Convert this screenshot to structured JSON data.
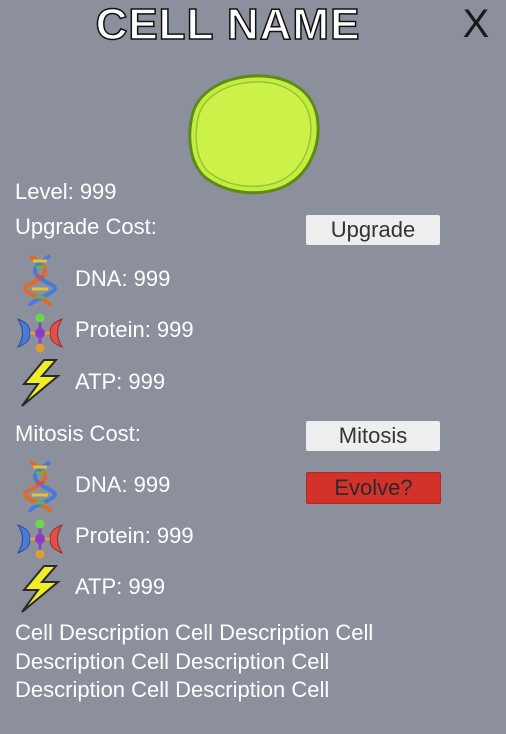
{
  "header": {
    "title": "CELL NAME",
    "close_label": "X"
  },
  "cell": {
    "color": "#ccf24a",
    "outline": "#6c8a1a"
  },
  "level_text": "Level: 999",
  "upgrade": {
    "cost_label": "Upgrade Cost:",
    "button_label": "Upgrade",
    "dna": "DNA: 999",
    "protein": "Protein: 999",
    "atp": "ATP: 999"
  },
  "mitosis": {
    "cost_label": "Mitosis Cost:",
    "button_label": "Mitosis",
    "evolve_label": "Evolve?",
    "dna": "DNA: 999",
    "protein": "Protein: 999",
    "atp": "ATP: 999"
  },
  "icons": [
    "dna-icon",
    "protein-icon",
    "lightning-bolt-icon"
  ],
  "description": "Cell Description Cell Description Cell Description Cell Description Cell Description Cell Description Cell"
}
